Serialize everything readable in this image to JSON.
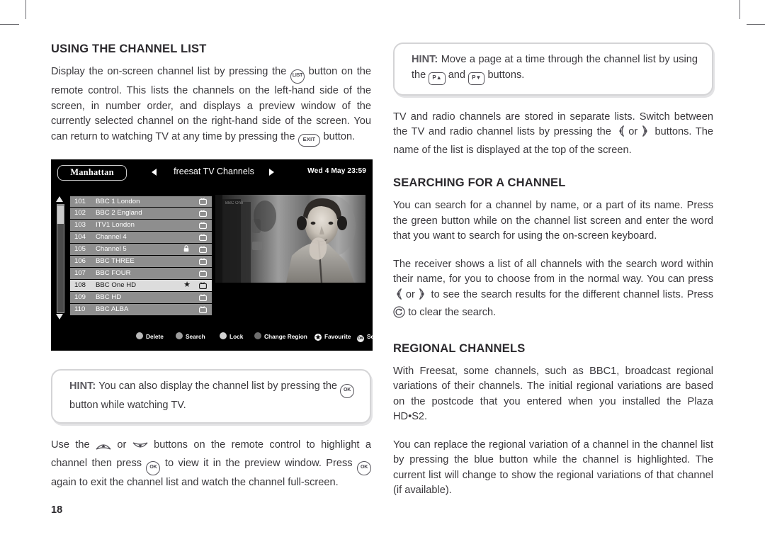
{
  "page": {
    "number": "18"
  },
  "left_column": {
    "heading": "USING THE CHANNEL LIST",
    "para1_a": "Display the on-screen channel list by pressing the",
    "para1_btn": "LIST",
    "para1_b": "button on the remote control. This lists the channels on the left-hand side of the screen, in number order, and displays a preview window of the currently selected channel on the right-hand side of the screen. You can return to watching TV at any time by pressing the",
    "para1_btn2": "EXIT",
    "para1_c": "button.",
    "hint": {
      "label": "HINT:",
      "text_a": "You can also display the channel list by pressing the",
      "btn": "OK",
      "text_b": "button while watching TV."
    },
    "para2_a": "Use the",
    "para2_or": "or",
    "para2_b": "buttons on the remote control to highlight a channel then press",
    "para2_btn1": "OK",
    "para2_c": "to view it in the preview window. Press",
    "para2_btn2": "OK",
    "para2_d": "again to exit the channel list and watch the channel full-screen."
  },
  "tv_screenshot": {
    "logo": "Manhattan",
    "list_name": "freesat TV Channels",
    "datetime": "Wed 4 May 23:59",
    "arrow_left_icon": "triangle-left-icon",
    "arrow_right_icon": "triangle-right-icon",
    "channels": [
      {
        "number": "101",
        "name": "BBC 1 London",
        "selected": false,
        "locked": false,
        "favourite": false
      },
      {
        "number": "102",
        "name": "BBC 2 England",
        "selected": false,
        "locked": false,
        "favourite": false
      },
      {
        "number": "103",
        "name": "ITV1 London",
        "selected": false,
        "locked": false,
        "favourite": false
      },
      {
        "number": "104",
        "name": "Channel 4",
        "selected": false,
        "locked": false,
        "favourite": false
      },
      {
        "number": "105",
        "name": "Channel 5",
        "selected": false,
        "locked": true,
        "favourite": false
      },
      {
        "number": "106",
        "name": "BBC THREE",
        "selected": false,
        "locked": false,
        "favourite": false
      },
      {
        "number": "107",
        "name": "BBC FOUR",
        "selected": false,
        "locked": false,
        "favourite": false
      },
      {
        "number": "108",
        "name": "BBC One HD",
        "selected": true,
        "locked": false,
        "favourite": true
      },
      {
        "number": "109",
        "name": "BBC HD",
        "selected": false,
        "locked": false,
        "favourite": false
      },
      {
        "number": "110",
        "name": "BBC ALBA",
        "selected": false,
        "locked": false,
        "favourite": false
      }
    ],
    "footer_buttons": [
      {
        "label": "Delete",
        "colour": "red",
        "icon": "dot-icon"
      },
      {
        "label": "Search",
        "colour": "green",
        "icon": "dot-icon"
      },
      {
        "label": "Lock",
        "colour": "yellow",
        "icon": "dot-icon"
      },
      {
        "label": "Change Region",
        "colour": "blue",
        "icon": "dot-icon"
      },
      {
        "label": "Favourite",
        "colour": "star",
        "icon": "star-icon"
      },
      {
        "label": "Select",
        "colour": "ok",
        "icon": "ok-button-icon"
      }
    ]
  },
  "right_column": {
    "hint": {
      "label": "HINT:",
      "text_a": "Move a page at a time through the channel list by using the",
      "btn1": "P",
      "text_and": "and",
      "btn2": "P",
      "text_b": "buttons."
    },
    "para_lists_a": "TV and radio channels are stored in separate lists. Switch between the TV and radio channel lists by pressing the",
    "para_lists_or": "or",
    "para_lists_b": "buttons. The name of the list is displayed at the top of the screen.",
    "heading_search": "SEARCHING FOR A CHANNEL",
    "search_para1": "You can search for a channel by name, or a part of its name. Press the green button while on the channel list screen and enter the word that you want to search for using the on-screen keyboard.",
    "search_para2_a": "The receiver shows a list of all channels with the search word within their name, for you to choose from in the normal way. You can press",
    "search_para2_or": "or",
    "search_para2_b": "to see the search results for the different channel lists. Press",
    "search_para2_c": "to clear the search.",
    "heading_regional": "REGIONAL CHANNELS",
    "regional_para1": "With Freesat, some channels, such as BBC1, broadcast regional variations of their channels. The initial regional variations are based on the postcode that you entered when you installed the Plaza HD•S2.",
    "regional_para2": "You can replace the regional variation of a channel in the channel list by pressing the blue button while the channel is highlighted. The current list will change to show the regional variations of that channel (if available)."
  }
}
